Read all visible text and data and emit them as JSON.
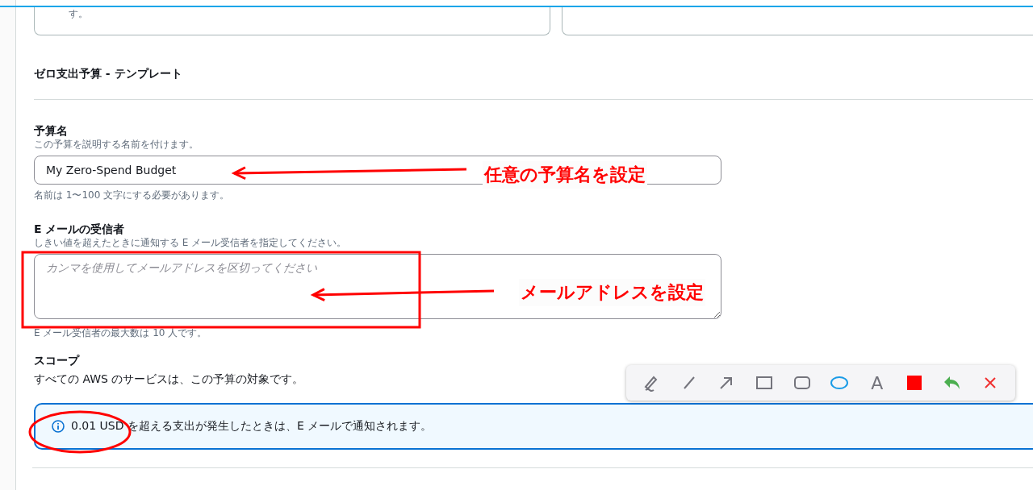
{
  "top_card": {
    "text": "す。"
  },
  "section": {
    "title": "ゼロ支出予算 - テンプレート"
  },
  "budget_name": {
    "label": "予算名",
    "description": "この予算を説明する名前を付けます。",
    "value": "My Zero-Spend Budget",
    "hint": "名前は 1〜100 文字にする必要があります。"
  },
  "email_recipients": {
    "label": "E メールの受信者",
    "description": "しきい値を超えたときに通知する E メール受信者を指定してください。",
    "placeholder": "カンマを使用してメールアドレスを区切ってください",
    "hint": "E メール受信者の最大数は 10 人です。"
  },
  "scope": {
    "label": "スコープ",
    "text": "すべての AWS のサービスは、この予算の対象です。"
  },
  "alert": {
    "text": "0.01 USD を超える支出が発生したときは、E メールで通知されます。"
  },
  "annotations": [
    {
      "kind": "arrow"
    },
    {
      "kind": "label",
      "text": "任意の予算名を設定"
    },
    {
      "kind": "rect"
    },
    {
      "kind": "arrow"
    },
    {
      "kind": "label",
      "text": "メールアドレスを設定"
    },
    {
      "kind": "ellipse"
    }
  ],
  "toolbar": {
    "tools": [
      {
        "kind": "pen"
      },
      {
        "kind": "line"
      },
      {
        "kind": "arrow"
      },
      {
        "kind": "rect"
      },
      {
        "kind": "rounded-rect"
      },
      {
        "kind": "ellipse"
      },
      {
        "kind": "text",
        "label": "A"
      },
      {
        "kind": "color",
        "color": "#ff0000"
      },
      {
        "kind": "undo"
      },
      {
        "kind": "close"
      }
    ]
  }
}
